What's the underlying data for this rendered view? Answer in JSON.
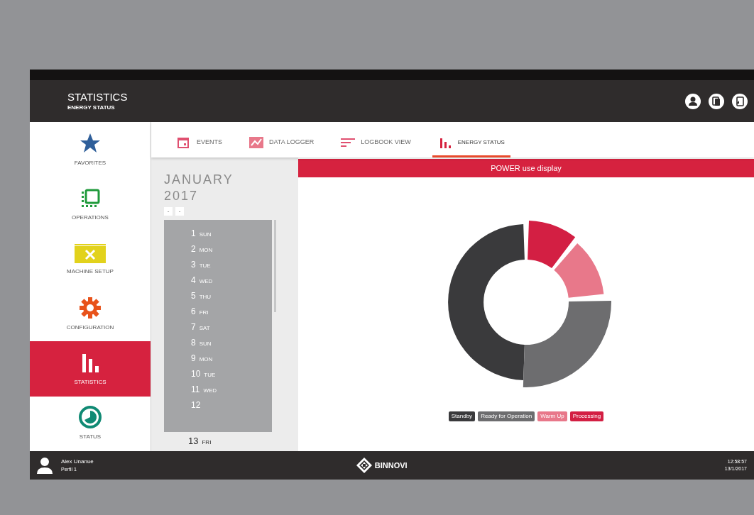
{
  "header": {
    "title": "STATISTICS",
    "subtitle": "ENERGY STATUS",
    "actions": [
      {
        "kind": "user"
      },
      {
        "kind": "copy"
      },
      {
        "kind": "export"
      }
    ]
  },
  "sidebar": {
    "items": [
      {
        "kind": "star",
        "label": "FAVORITES",
        "selected": false
      },
      {
        "kind": "operations",
        "label": "OPERATIONS",
        "selected": false
      },
      {
        "kind": "setup",
        "label": "MACHINE SETUP",
        "selected": false
      },
      {
        "kind": "gear",
        "label": "CONFIGURATION",
        "selected": false
      },
      {
        "kind": "bars",
        "label": "STATISTICS",
        "selected": true
      },
      {
        "kind": "clock",
        "label": "STATUS",
        "selected": false
      }
    ]
  },
  "tabs": [
    {
      "kind": "calendar",
      "label": "EVENTS",
      "selected": false
    },
    {
      "kind": "graph",
      "label": "DATA LOGGER",
      "selected": false
    },
    {
      "kind": "lines",
      "label": "LOGBOOK VIEW",
      "selected": false
    },
    {
      "kind": "bars",
      "label": "ENERGY STATUS",
      "selected": true
    }
  ],
  "calendar": {
    "month": "JANUARY",
    "year": "2017",
    "nav": [
      "-",
      "-"
    ],
    "days": [
      {
        "day": "1",
        "weekday": "SUN",
        "selected": false
      },
      {
        "day": "2",
        "weekday": "MON",
        "selected": false
      },
      {
        "day": "3",
        "weekday": "TUE",
        "selected": false
      },
      {
        "day": "4",
        "weekday": "WED",
        "selected": false
      },
      {
        "day": "5",
        "weekday": "THU",
        "selected": false
      },
      {
        "day": "6",
        "weekday": "FRI",
        "selected": false
      },
      {
        "day": "7",
        "weekday": "SAT",
        "selected": false
      },
      {
        "day": "8",
        "weekday": "SUN",
        "selected": false
      },
      {
        "day": "9",
        "weekday": "MON",
        "selected": false
      },
      {
        "day": "10",
        "weekday": "TUE",
        "selected": false
      },
      {
        "day": "11",
        "weekday": "WED",
        "selected": false
      },
      {
        "day": "12",
        "selected": false
      }
    ],
    "current": {
      "day": "13",
      "weekday": "FRI"
    }
  },
  "panel": {
    "title": "POWER use display",
    "legend": [
      {
        "label": "Standby",
        "color": "#3a3a3c"
      },
      {
        "label": "Ready for Operation",
        "color": "#6d6d6f"
      },
      {
        "label": "Warm Up",
        "color": "#e8788a"
      },
      {
        "label": "Processing",
        "color": "#d31f43"
      }
    ]
  },
  "footer": {
    "user": "Alex Unanue",
    "profile": "Perfil 1",
    "brand": "BINNOVI",
    "time": "12:58:57",
    "date": "13/1/2017"
  }
}
